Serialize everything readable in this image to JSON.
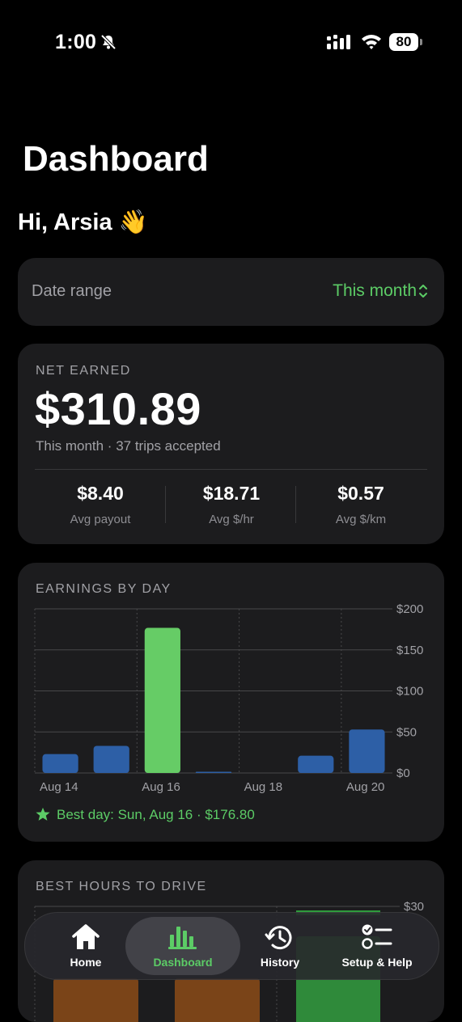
{
  "status_bar": {
    "time": "1:00",
    "battery": "80"
  },
  "page": {
    "title": "Dashboard",
    "greeting": "Hi, Arsia 👋"
  },
  "date_range": {
    "label": "Date range",
    "value": "This month"
  },
  "net_earned": {
    "label": "NET EARNED",
    "amount": "$310.89",
    "subtitle": "This month · 37 trips accepted",
    "stats": [
      {
        "value": "$8.40",
        "label": "Avg payout"
      },
      {
        "value": "$18.71",
        "label": "Avg $/hr"
      },
      {
        "value": "$0.57",
        "label": "Avg $/km"
      }
    ]
  },
  "earnings_by_day": {
    "label": "EARNINGS BY DAY",
    "best_day": "Best day: Sun, Aug 16 · $176.80"
  },
  "best_hours": {
    "label": "BEST HOURS TO DRIVE",
    "y_tick_top": "$30"
  },
  "chart_data": {
    "type": "bar",
    "categories": [
      "Aug 14",
      "Aug 15",
      "Aug 16",
      "Aug 17",
      "Aug 18",
      "Aug 19",
      "Aug 20"
    ],
    "x_tick_labels": [
      "Aug 14",
      "Aug 16",
      "Aug 18",
      "Aug 20"
    ],
    "values": [
      23,
      33,
      176.8,
      1.5,
      0,
      21,
      53
    ],
    "highlight_index": 2,
    "ylim": [
      0,
      200
    ],
    "y_ticks": [
      0,
      50,
      100,
      150,
      200
    ],
    "y_tick_labels": [
      "$0",
      "$50",
      "$100",
      "$150",
      "$200"
    ],
    "colors": {
      "bar": "#2d5fa6",
      "highlight": "#66cc66",
      "grid": "#48484a"
    },
    "grid": true
  },
  "tab_bar": {
    "active": "Dashboard",
    "items": [
      {
        "label": "Home",
        "icon": "house-icon"
      },
      {
        "label": "Dashboard",
        "icon": "bar-chart-icon"
      },
      {
        "label": "History",
        "icon": "clock-history-icon"
      },
      {
        "label": "Setup & Help",
        "icon": "checklist-icon"
      }
    ]
  }
}
